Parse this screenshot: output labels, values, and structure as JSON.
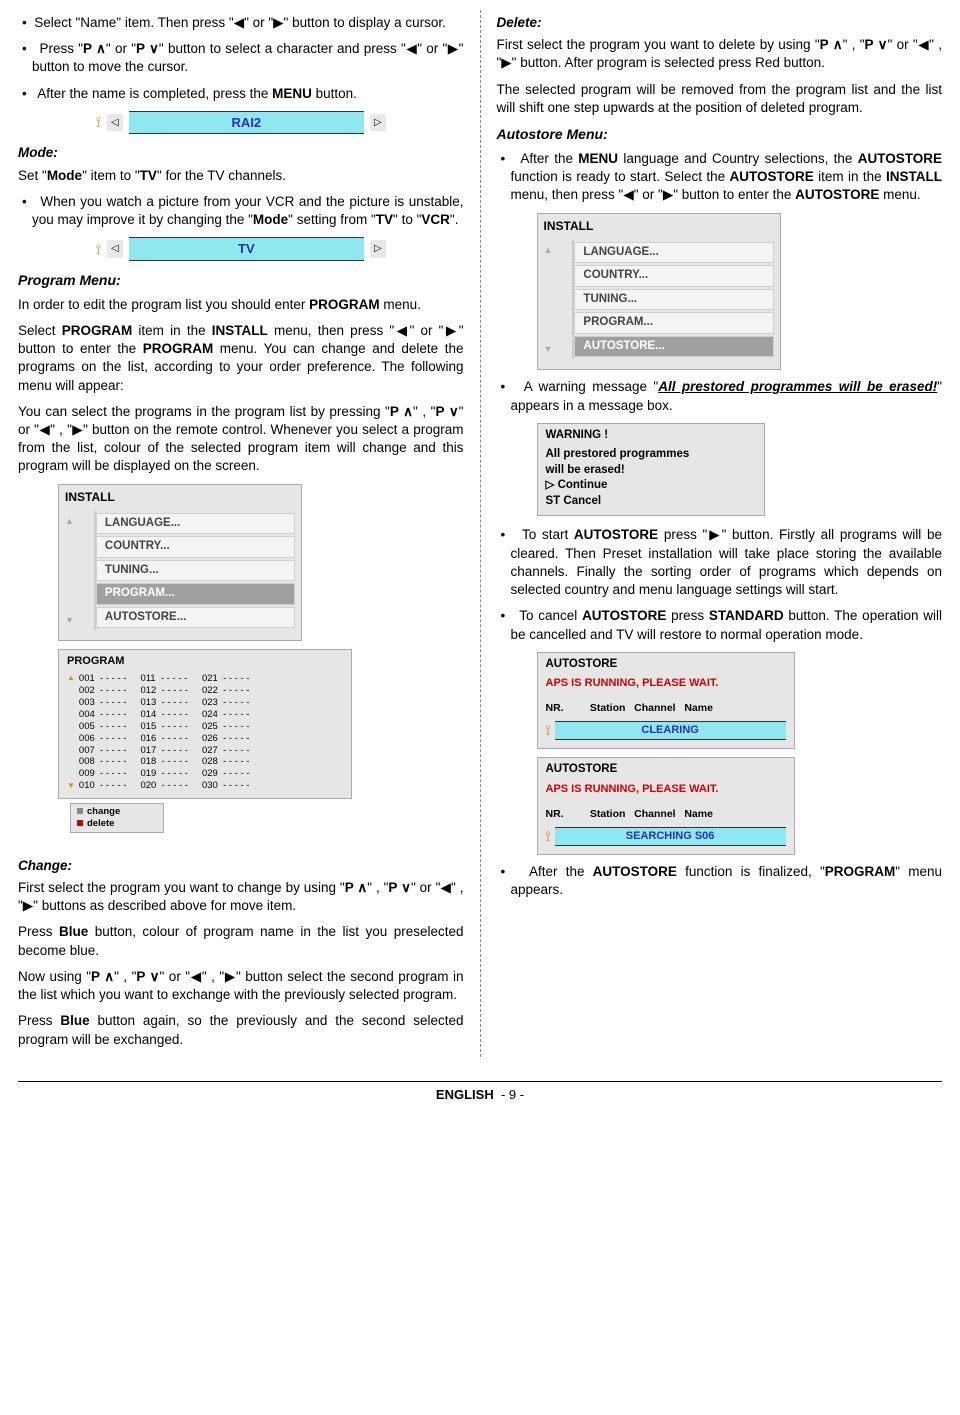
{
  "left": {
    "b1": "Select \"Name\" item. Then press \"◀\" or \"▶\" button to display a cursor.",
    "b2_a": "Press \"",
    "b2_b": "\" or \"",
    "b2_c": "\" button to select a character and press \"◀\" or \"▶\" button to move the cursor.",
    "b3": "After the name is completed, press the MENU button.",
    "osd1": "RAI2",
    "mode_h": "Mode:",
    "mode_p1": "Set \"Mode\" item to \"TV\" for the TV channels.",
    "mode_b1": "When you watch a picture from your VCR and the picture is unstable, you may improve it by changing the \"Mode\" setting from \"TV\" to \"VCR\".",
    "osd2": "TV",
    "prog_h": "Program Menu:",
    "prog_p1": "In order to edit the program list you should enter PROGRAM menu.",
    "prog_p2": "Select PROGRAM item in the INSTALL menu, then press \"◀\" or \"▶\" button to enter the PROGRAM menu. You can  change and delete the programs on the list, according to your order preference. The following menu will appear:",
    "prog_p3_a": "You can select the programs in the program list by pressing \"",
    "prog_p3_b": "\" , \"",
    "prog_p3_c": "\" or \"◀\" , \"▶\" button on the remote control. Whenever you select a program from the list, colour of the selected program item will change and this program will be displayed on the screen.",
    "install_title": "INSTALL",
    "menu_items": [
      "LANGUAGE...",
      "COUNTRY...",
      "TUNING...",
      "PROGRAM...",
      "AUTOSTORE..."
    ],
    "menu_hl_idx": 3,
    "program_box_title": "PROGRAM",
    "program_rows": [
      [
        "001  - - - - -",
        "011  - - - - -",
        "021  - - - - -"
      ],
      [
        "002  - - - - -",
        "012  - - - - -",
        "022  - - - - -"
      ],
      [
        "003  - - - - -",
        "013  - - - - -",
        "023  - - - - -"
      ],
      [
        "004  - - - - -",
        "014  - - - - -",
        "024  - - - - -"
      ],
      [
        "005  - - - - -",
        "015  - - - - -",
        "025  - - - - -"
      ],
      [
        "006  - - - - -",
        "016  - - - - -",
        "026  - - - - -"
      ],
      [
        "007  - - - - -",
        "017  - - - - -",
        "027  - - - - -"
      ],
      [
        "008  - - - - -",
        "018  - - - - -",
        "028  - - - - -"
      ],
      [
        "009  - - - - -",
        "019  - - - - -",
        "029  - - - - -"
      ],
      [
        "010  - - - - -",
        "020  - - - - -",
        "030  - - - - -"
      ]
    ],
    "change_lbl": "change",
    "delete_lbl": "delete",
    "change_h": "Change:",
    "change_p1_a": "First select the program you want to change by using \"",
    "change_p1_b": "\" , \"",
    "change_p1_c": "\" or \"◀\" , \"▶\" buttons as described above for move item.",
    "change_p2": "Press Blue button, colour of program name in the list you preselected become blue.",
    "change_p3_a": "Now using \"",
    "change_p3_b": "\" , \"",
    "change_p3_c": "\" or \"◀\" , \"▶\" button select the second program in the list which you want to exchange with the previously selected program.",
    "change_p4": "Press Blue button again, so the previously and the second selected program will be exchanged."
  },
  "right": {
    "del_h": "Delete:",
    "del_p1_a": "First select the program you want to delete by using \"",
    "del_p1_b": "\" , \"",
    "del_p1_c": "\" or \"◀\" , \"▶\" button. After program is selected press Red button.",
    "del_p2": "The selected program will be removed from the program list and the list will shift one step upwards at the position of deleted program.",
    "auto_h": "Autostore Menu:",
    "auto_b1": "After the MENU language and Country selections, the AUTOSTORE function is ready to start. Select the AUTOSTORE item in the INSTALL menu, then press \"◀\" or \"▶\" button to enter the AUTOSTORE menu.",
    "install_title": "INSTALL",
    "menu_items": [
      "LANGUAGE...",
      "COUNTRY...",
      "TUNING...",
      "PROGRAM...",
      "AUTOSTORE..."
    ],
    "menu_hl_idx": 4,
    "auto_b2_a": "A warning message \"",
    "auto_b2_u": "All prestored programmes will be erased!",
    "auto_b2_b": "\" appears in a message box.",
    "warn_title": "WARNING !",
    "warn_l1": "All prestored programmes",
    "warn_l2": "will be erased!",
    "warn_cont": "Continue",
    "warn_cancel": "ST   Cancel",
    "auto_b3": "To start AUTOSTORE press \"▶\" button. Firstly all programs will be cleared. Then Preset installation will take place storing the available channels. Finally the sorting order of programs which depends on selected country and menu language settings will start.",
    "auto_b4": "To cancel AUTOSTORE press STANDARD button. The operation will be cancelled and TV will restore to normal operation mode.",
    "aps_title": "AUTOSTORE",
    "aps1": "APS IS RUNNING, PLEASE WAIT.",
    "aps_headers": "NR.         Station   Channel   Name",
    "clearing": "CLEARING",
    "searching": "SEARCHING    S06",
    "auto_p5": "After the AUTOSTORE function is finalized, \"PROGRAM\" menu appears."
  },
  "footer": {
    "lang": "ENGLISH",
    "page": "- 9 -"
  },
  "sym": {
    "P": "P",
    "up": "∧",
    "dn": "∨",
    "tri": "▷"
  }
}
